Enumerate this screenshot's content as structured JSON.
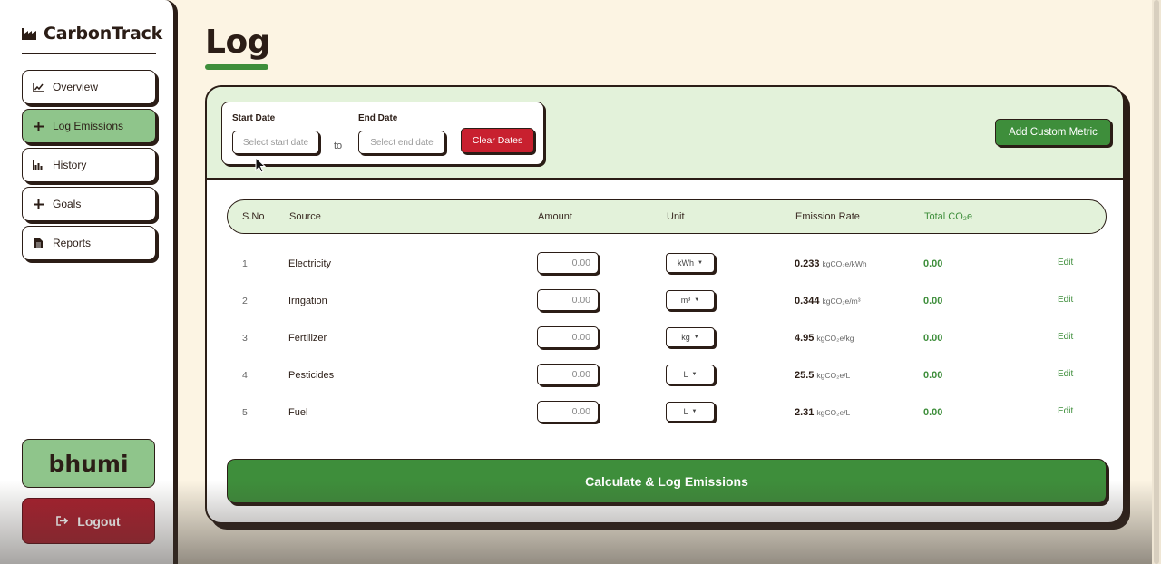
{
  "brand": {
    "name": "CarbonTrack",
    "icon": "factory-icon"
  },
  "sidebar": {
    "items": [
      {
        "label": "Overview",
        "icon": "line-chart-icon",
        "active": false
      },
      {
        "label": "Log Emissions",
        "icon": "plus-icon",
        "active": true
      },
      {
        "label": "History",
        "icon": "bar-chart-icon",
        "active": false
      },
      {
        "label": "Goals",
        "icon": "plus-icon",
        "active": false
      },
      {
        "label": "Reports",
        "icon": "file-icon",
        "active": false
      }
    ],
    "user": "bhumi",
    "logout_label": "Logout",
    "logout_icon": "sign-out-icon"
  },
  "page": {
    "title": "Log"
  },
  "date_filter": {
    "start_label": "Start Date",
    "start_placeholder": "Select start date",
    "to_text": "to",
    "end_label": "End Date",
    "end_placeholder": "Select end date",
    "clear_label": "Clear Dates"
  },
  "add_metric_label": "Add Custom Metric",
  "table": {
    "headers": {
      "sno": "S.No",
      "source": "Source",
      "amount": "Amount",
      "unit": "Unit",
      "rate": "Emission Rate",
      "total": "Total CO₂e"
    },
    "rows": [
      {
        "sno": "1",
        "source": "Electricity",
        "amount": "0.00",
        "unit": "kWh",
        "rate": "0.233",
        "rate_unit": "kgCO₂e/kWh",
        "total": "0.00",
        "edit": "Edit"
      },
      {
        "sno": "2",
        "source": "Irrigation",
        "amount": "0.00",
        "unit": "m³",
        "rate": "0.344",
        "rate_unit": "kgCO₂e/m³",
        "total": "0.00",
        "edit": "Edit"
      },
      {
        "sno": "3",
        "source": "Fertilizer",
        "amount": "0.00",
        "unit": "kg",
        "rate": "4.95",
        "rate_unit": "kgCO₂e/kg",
        "total": "0.00",
        "edit": "Edit"
      },
      {
        "sno": "4",
        "source": "Pesticides",
        "amount": "0.00",
        "unit": "L",
        "rate": "25.5",
        "rate_unit": "kgCO₂e/L",
        "total": "0.00",
        "edit": "Edit"
      },
      {
        "sno": "5",
        "source": "Fuel",
        "amount": "0.00",
        "unit": "L",
        "rate": "2.31",
        "rate_unit": "kgCO₂e/L",
        "total": "0.00",
        "edit": "Edit"
      }
    ]
  },
  "calculate_label": "Calculate & Log Emissions",
  "colors": {
    "background": "#fcf4e3",
    "accent_green": "#3e8e3b",
    "active_green": "#8fc58b",
    "light_green": "#e3f2da",
    "danger_red": "#c8202f",
    "ink": "#2b1d16"
  }
}
